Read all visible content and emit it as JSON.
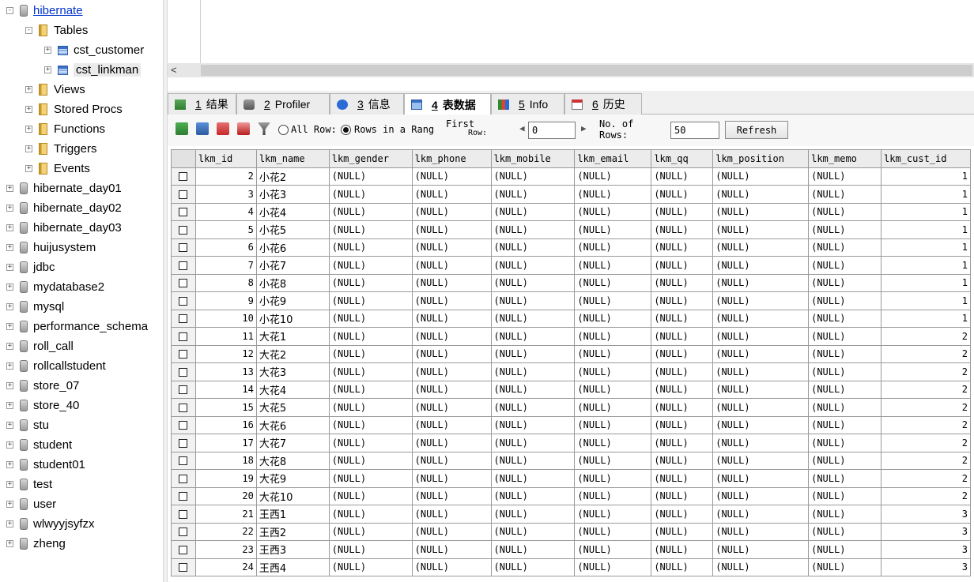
{
  "tree": {
    "active_db": "hibernate",
    "folders": [
      "Tables",
      "Views",
      "Stored Procs",
      "Functions",
      "Triggers",
      "Events"
    ],
    "tables": [
      "cst_customer",
      "cst_linkman"
    ],
    "databases": [
      "hibernate_day01",
      "hibernate_day02",
      "hibernate_day03",
      "huijusystem",
      "jdbc",
      "mydatabase2",
      "mysql",
      "performance_schema",
      "roll_call",
      "rollcallstudent",
      "store_07",
      "store_40",
      "stu",
      "student",
      "student01",
      "test",
      "user",
      "wlwyyjsyfzx",
      "zheng"
    ]
  },
  "editor": {
    "scroll_left_arrow": "<"
  },
  "tabs": [
    {
      "num": "1",
      "label": "结果"
    },
    {
      "num": "2",
      "label": "Profiler"
    },
    {
      "num": "3",
      "label": "信息"
    },
    {
      "num": "4",
      "label": "表数据"
    },
    {
      "num": "5",
      "label": "Info"
    },
    {
      "num": "6",
      "label": "历史"
    }
  ],
  "toolbar": {
    "all_rows": "All Row:",
    "rows_range": "Rows in a Rang",
    "first_row_1": "First",
    "first_row_2": "Row:",
    "first_row_value": "0",
    "no_rows_1": "No. of",
    "no_rows_2": "Rows:",
    "no_rows_value": "50",
    "refresh": "Refresh"
  },
  "grid": {
    "columns": [
      "lkm_id",
      "lkm_name",
      "lkm_gender",
      "lkm_phone",
      "lkm_mobile",
      "lkm_email",
      "lkm_qq",
      "lkm_position",
      "lkm_memo",
      "lkm_cust_id"
    ],
    "null_text": "(NULL)",
    "rows": [
      {
        "id": "2",
        "name": "小花2",
        "cust": "1"
      },
      {
        "id": "3",
        "name": "小花3",
        "cust": "1"
      },
      {
        "id": "4",
        "name": "小花4",
        "cust": "1"
      },
      {
        "id": "5",
        "name": "小花5",
        "cust": "1"
      },
      {
        "id": "6",
        "name": "小花6",
        "cust": "1"
      },
      {
        "id": "7",
        "name": "小花7",
        "cust": "1"
      },
      {
        "id": "8",
        "name": "小花8",
        "cust": "1"
      },
      {
        "id": "9",
        "name": "小花9",
        "cust": "1"
      },
      {
        "id": "10",
        "name": "小花10",
        "cust": "1"
      },
      {
        "id": "11",
        "name": "大花1",
        "cust": "2"
      },
      {
        "id": "12",
        "name": "大花2",
        "cust": "2"
      },
      {
        "id": "13",
        "name": "大花3",
        "cust": "2"
      },
      {
        "id": "14",
        "name": "大花4",
        "cust": "2"
      },
      {
        "id": "15",
        "name": "大花5",
        "cust": "2"
      },
      {
        "id": "16",
        "name": "大花6",
        "cust": "2"
      },
      {
        "id": "17",
        "name": "大花7",
        "cust": "2"
      },
      {
        "id": "18",
        "name": "大花8",
        "cust": "2"
      },
      {
        "id": "19",
        "name": "大花9",
        "cust": "2"
      },
      {
        "id": "20",
        "name": "大花10",
        "cust": "2"
      },
      {
        "id": "21",
        "name": "王西1",
        "cust": "3"
      },
      {
        "id": "22",
        "name": "王西2",
        "cust": "3"
      },
      {
        "id": "23",
        "name": "王西3",
        "cust": "3"
      },
      {
        "id": "24",
        "name": "王西4",
        "cust": "3"
      }
    ]
  }
}
